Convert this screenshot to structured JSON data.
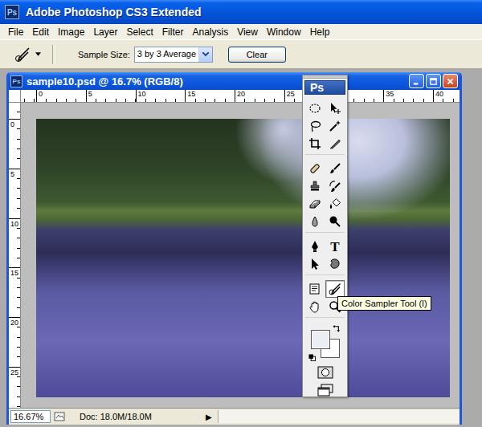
{
  "window": {
    "title": "Adobe Photoshop CS3 Extended",
    "app_badge": "Ps"
  },
  "menu": [
    "File",
    "Edit",
    "Image",
    "Layer",
    "Select",
    "Filter",
    "Analysis",
    "View",
    "Window",
    "Help"
  ],
  "options_bar": {
    "sample_size_label": "Sample Size:",
    "sample_size": "3 by 3 Average",
    "clear_button": "Clear"
  },
  "document": {
    "title": "sample10.psd @ 16.7% (RGB/8)",
    "ruler_top": [
      "0",
      "5",
      "10",
      "15",
      "20",
      "25",
      "35",
      "40"
    ],
    "ruler_left": [
      "0",
      "5",
      "10",
      "15",
      "20",
      "25"
    ],
    "zoom": "16.67%",
    "doc_info": "Doc: 18.0M/18.0M",
    "info_arrow": "▶"
  },
  "toolbox": {
    "badge": "Ps",
    "tool_groups": [
      [
        {
          "kind": "marquee",
          "selected": false
        },
        {
          "kind": "move",
          "selected": false
        },
        {
          "kind": "lasso",
          "selected": false
        },
        {
          "kind": "magic-wand",
          "selected": false
        },
        {
          "kind": "crop",
          "selected": false
        },
        {
          "kind": "slice",
          "selected": false
        }
      ],
      [
        {
          "kind": "healing",
          "selected": false
        },
        {
          "kind": "brush",
          "selected": false
        },
        {
          "kind": "stamp",
          "selected": false
        },
        {
          "kind": "history-brush",
          "selected": false
        },
        {
          "kind": "eraser",
          "selected": false
        },
        {
          "kind": "bucket",
          "selected": false
        },
        {
          "kind": "blur",
          "selected": false
        },
        {
          "kind": "dodge",
          "selected": false
        }
      ],
      [
        {
          "kind": "pen",
          "selected": false
        },
        {
          "kind": "type",
          "glyph": "T",
          "selected": false
        },
        {
          "kind": "path-select",
          "selected": false
        },
        {
          "kind": "shape",
          "selected": false
        }
      ],
      [
        {
          "kind": "notes",
          "selected": false
        },
        {
          "kind": "color-sampler",
          "selected": true
        },
        {
          "kind": "hand",
          "selected": false
        },
        {
          "kind": "zoom",
          "selected": false
        }
      ]
    ],
    "foreground_color": "#eceef5",
    "background_color": "#ffffff"
  },
  "tooltip": "Color Sampler Tool (I)"
}
